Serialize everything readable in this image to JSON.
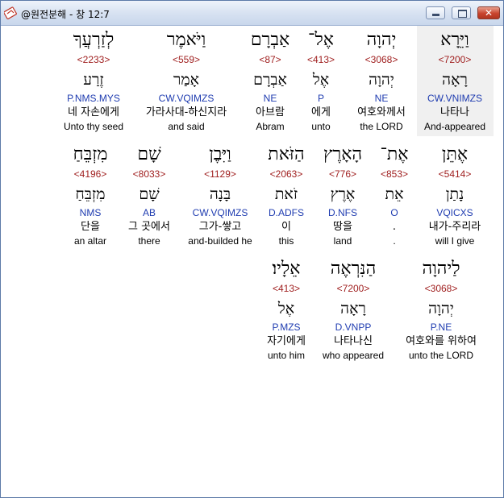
{
  "window": {
    "title": "@원전분해 - 창 12:7",
    "close_label": "✕"
  },
  "rows": [
    [
      {
        "hebrew": "וַיֵּרָא",
        "strong": "<7200>",
        "lemma": "רָאָה",
        "parsing": "CW.VNIMZS",
        "korean": "나타나",
        "english": "And-appeared",
        "selected": true
      },
      {
        "hebrew": "יְהוָה",
        "strong": "<3068>",
        "lemma": "יְהוָה",
        "parsing": "NE",
        "korean": "여호와께서",
        "english": "the LORD"
      },
      {
        "hebrew": "אֶל־",
        "strong": "<413>",
        "lemma": "אֶל",
        "parsing": "P",
        "korean": "에게",
        "english": "unto"
      },
      {
        "hebrew": "אַבְרָם",
        "strong": "<87>",
        "lemma": "אַבְרָם",
        "parsing": "NE",
        "korean": "아브람",
        "english": "Abram"
      },
      {
        "hebrew": "וַיֹּאמֶר",
        "strong": "<559>",
        "lemma": "אָמַר",
        "parsing": "CW.VQIMZS",
        "korean": "가라사대-하신지라",
        "english": "and said"
      },
      {
        "hebrew": "לְזַרְעֲךָ",
        "strong": "<2233>",
        "lemma": "זֶרַע",
        "parsing": "P.NMS.MYS",
        "korean": "네 자손에게",
        "english": "Unto thy seed"
      }
    ],
    [
      {
        "hebrew": "אֶתֵּן",
        "strong": "<5414>",
        "lemma": "נָתַן",
        "parsing": "VQICXS",
        "korean": "내가-주리라",
        "english": "will I give"
      },
      {
        "hebrew": "אֶת־",
        "strong": "<853>",
        "lemma": "אֵת",
        "parsing": "O",
        "korean": ".",
        "english": "."
      },
      {
        "hebrew": "הָאָרֶץ",
        "strong": "<776>",
        "lemma": "אֶרֶץ",
        "parsing": "D.NFS",
        "korean": "땅을",
        "english": "land"
      },
      {
        "hebrew": "הַזֹּאת",
        "strong": "<2063>",
        "lemma": "זֹאת",
        "parsing": "D.ADFS",
        "korean": "이",
        "english": "this"
      },
      {
        "hebrew": "וַיִּבֶן",
        "strong": "<1129>",
        "lemma": "בָּנָה",
        "parsing": "CW.VQIMZS",
        "korean": "그가-쌓고",
        "english": "and-builded he"
      },
      {
        "hebrew": "שָׁם",
        "strong": "<8033>",
        "lemma": "שָׁם",
        "parsing": "AB",
        "korean": "그 곳에서",
        "english": "there"
      },
      {
        "hebrew": "מִזְבֵּחַ",
        "strong": "<4196>",
        "lemma": "מִזְבֵּחַ",
        "parsing": "NMS",
        "korean": "단을",
        "english": "an altar"
      }
    ],
    [
      {
        "hebrew": "לַיהוָה",
        "strong": "<3068>",
        "lemma": "יְהוָה",
        "parsing": "P.NE",
        "korean": "여호와를 위하여",
        "english": "unto the LORD"
      },
      {
        "hebrew": "הַנִּרְאֶה",
        "strong": "<7200>",
        "lemma": "רָאָה",
        "parsing": "D.VNPP",
        "korean": "나타나신",
        "english": "who appeared"
      },
      {
        "hebrew": "אֵלָיו׃",
        "strong": "<413>",
        "lemma": "אֶל",
        "parsing": "P.MZS",
        "korean": "자기에게",
        "english": "unto him"
      }
    ]
  ]
}
